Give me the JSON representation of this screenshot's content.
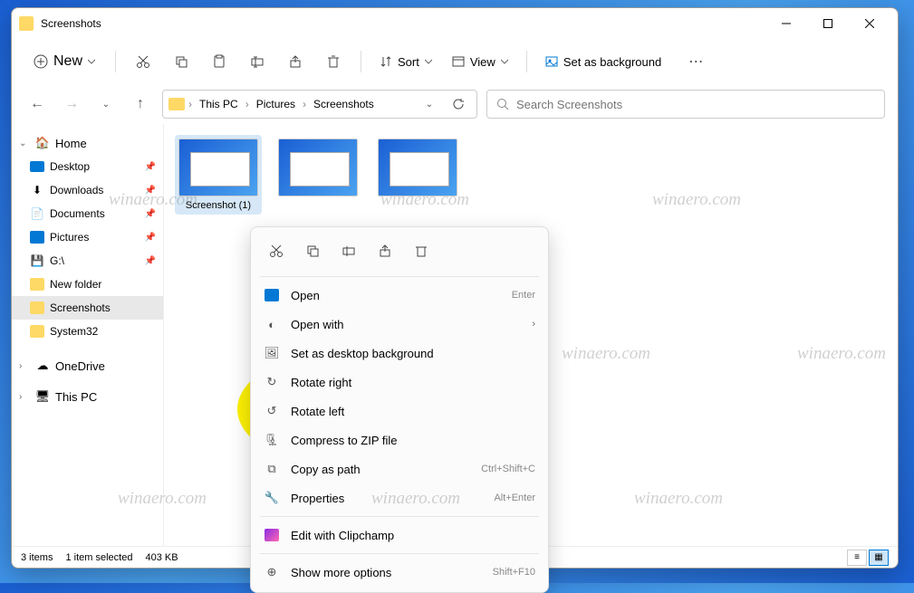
{
  "window": {
    "title": "Screenshots"
  },
  "toolbar": {
    "new_label": "New",
    "sort_label": "Sort",
    "view_label": "View",
    "bg_label": "Set as background"
  },
  "breadcrumb": {
    "items": [
      "This PC",
      "Pictures",
      "Screenshots"
    ]
  },
  "search": {
    "placeholder": "Search Screenshots"
  },
  "sidebar": {
    "home": "Home",
    "items": [
      {
        "label": "Desktop",
        "icon": "desktop",
        "pinned": true
      },
      {
        "label": "Downloads",
        "icon": "downloads",
        "pinned": true
      },
      {
        "label": "Documents",
        "icon": "documents",
        "pinned": true
      },
      {
        "label": "Pictures",
        "icon": "pictures",
        "pinned": true
      },
      {
        "label": "G:\\",
        "icon": "drive",
        "pinned": true
      },
      {
        "label": "New folder",
        "icon": "folder",
        "pinned": false
      },
      {
        "label": "Screenshots",
        "icon": "folder",
        "pinned": false,
        "selected": true
      },
      {
        "label": "System32",
        "icon": "folder",
        "pinned": false
      }
    ],
    "onedrive": "OneDrive",
    "thispc": "This PC"
  },
  "files": [
    {
      "label": "Screenshot (1)",
      "selected": true
    },
    {
      "label": "",
      "selected": false
    },
    {
      "label": "",
      "selected": false
    }
  ],
  "status": {
    "count": "3 items",
    "selected": "1 item selected",
    "size": "403 KB"
  },
  "context_menu": {
    "open": "Open",
    "open_sc": "Enter",
    "open_with": "Open with",
    "set_bg": "Set as desktop background",
    "rotate_right": "Rotate right",
    "rotate_left": "Rotate left",
    "compress": "Compress to ZIP file",
    "copy_path": "Copy as path",
    "copy_path_sc": "Ctrl+Shift+C",
    "properties": "Properties",
    "properties_sc": "Alt+Enter",
    "clipchamp": "Edit with Clipchamp",
    "more": "Show more options",
    "more_sc": "Shift+F10"
  },
  "watermark": "winaero.com"
}
